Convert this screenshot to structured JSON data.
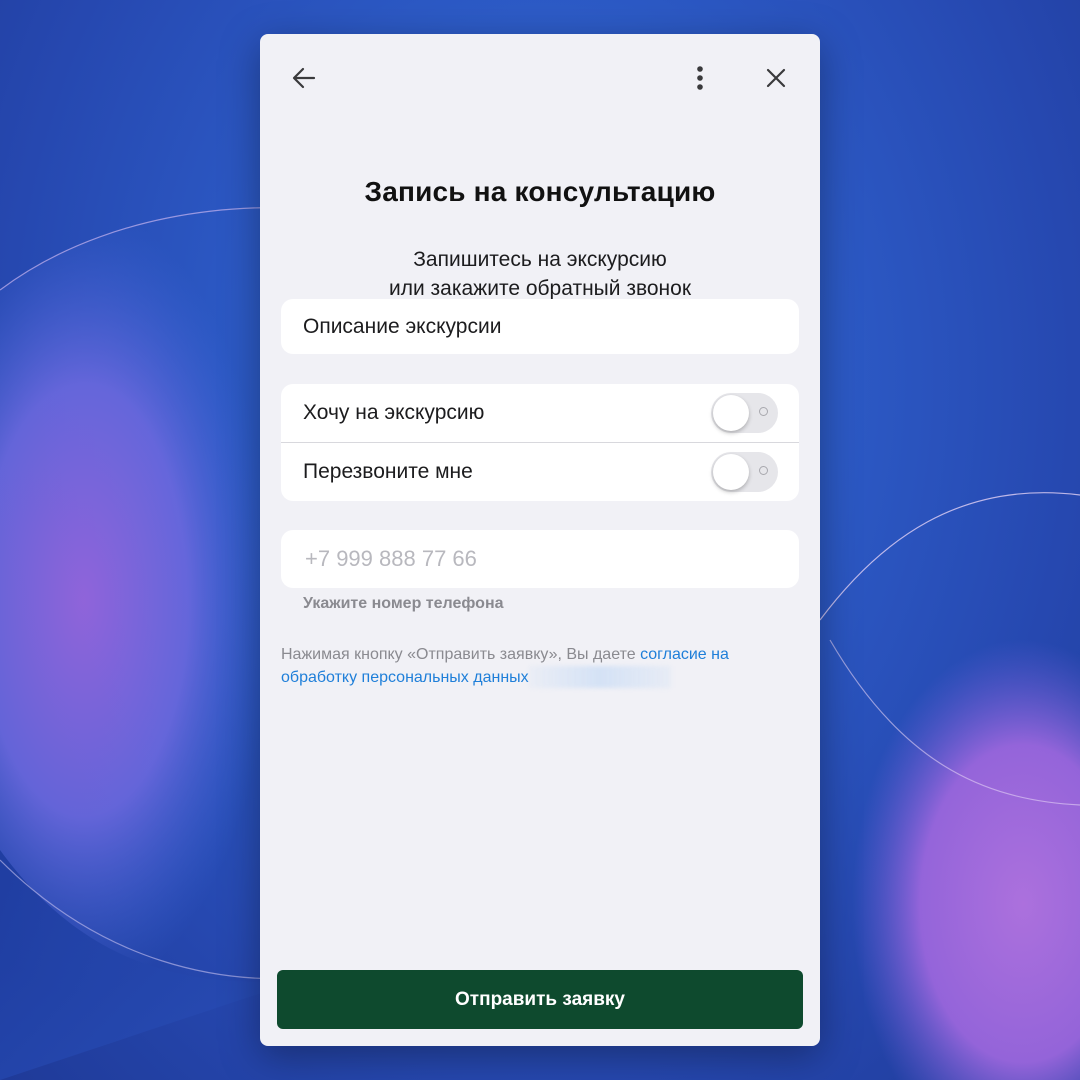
{
  "header": {
    "back_icon": "arrow-left-icon",
    "more_icon": "more-vertical-icon",
    "close_icon": "close-icon"
  },
  "title": "Запись на консультацию",
  "subtitle": {
    "line1": "Запишитесь на экскурсию",
    "line2": "или закажите обратный звонок"
  },
  "tour_description": {
    "label": "Описание экскурсии"
  },
  "toggles": [
    {
      "label": "Хочу на экскурсию",
      "checked": false
    },
    {
      "label": "Перезвоните мне",
      "checked": false
    }
  ],
  "phone": {
    "value": "",
    "placeholder": "+7 999 888 77 66",
    "hint": "Укажите номер телефона"
  },
  "consent": {
    "text": "Нажимая кнопку «Отправить заявку», Вы даете ",
    "link": "согласие на обработку персональных данных"
  },
  "submit": {
    "label": "Отправить заявку"
  },
  "colors": {
    "background_blue": "#2d5cc8",
    "background_purple": "#9b5ed8",
    "modal_bg": "#f1f1f6",
    "button_green": "#0e4a2e",
    "link_blue": "#1f7fd9",
    "hint_gray": "#8a8a90"
  }
}
